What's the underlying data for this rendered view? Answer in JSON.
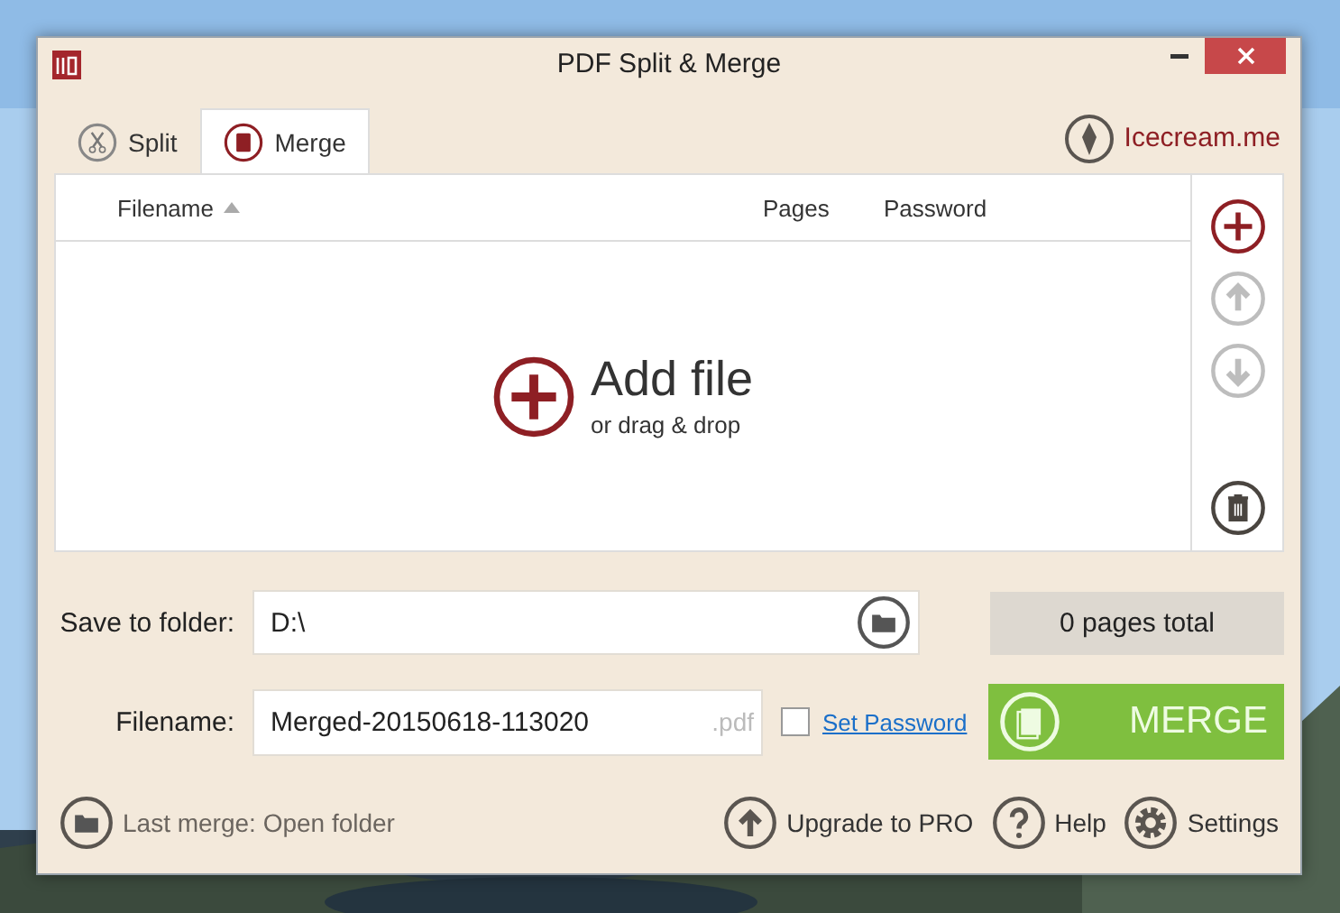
{
  "window": {
    "title": "PDF Split & Merge"
  },
  "tabs": [
    {
      "label": "Split",
      "kind": "split",
      "selected": false
    },
    {
      "label": "Merge",
      "kind": "merge",
      "selected": true
    }
  ],
  "brand_link": "Icecream.me",
  "table": {
    "columns": [
      "Filename",
      "Pages",
      "Password"
    ],
    "empty_title": "Add file",
    "empty_hint": "or drag & drop"
  },
  "side_buttons": [
    {
      "kind": "add",
      "disabled": false
    },
    {
      "kind": "up",
      "disabled": true
    },
    {
      "kind": "down",
      "disabled": true
    },
    {
      "kind": "delete",
      "disabled": false
    }
  ],
  "save_folder": {
    "label": "Save to folder:",
    "value": "D:\\"
  },
  "pages_total": "0 pages total",
  "filename": {
    "label": "Filename:",
    "value": "Merged-20150618-113020",
    "extension": ".pdf"
  },
  "password": {
    "checked": false,
    "link": "Set Password"
  },
  "merge_button": "MERGE",
  "last_merge": "Last merge: Open folder",
  "footer_buttons": [
    {
      "kind": "upgrade",
      "label": "Upgrade to PRO"
    },
    {
      "kind": "help",
      "label": "Help"
    },
    {
      "kind": "settings",
      "label": "Settings"
    }
  ]
}
